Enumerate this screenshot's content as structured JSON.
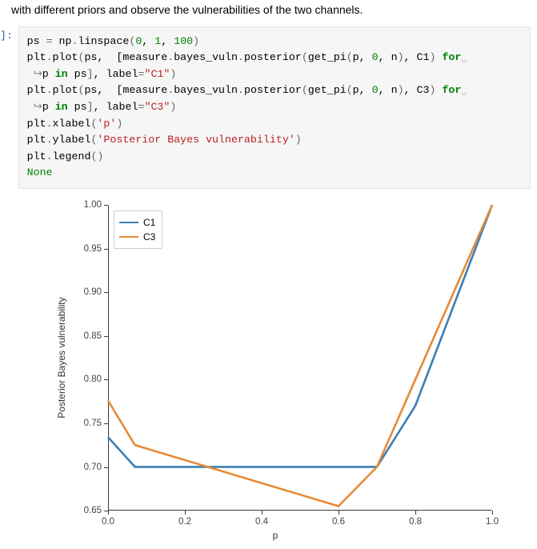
{
  "intro_text": "with different priors and observe the vulnerabilities of the two channels.",
  "prompt_in": "]:",
  "code": {
    "l1_a": "ps ",
    "l1_b": " np",
    "l1_c": "linspace",
    "l1_lp": "(",
    "l1_n1": "0",
    "l1_c1": ", ",
    "l1_n2": "1",
    "l1_c2": ", ",
    "l1_n3": "100",
    "l1_rp": ")",
    "plt": "plt",
    "dot": ".",
    "eq": "=",
    "plot": "plot",
    "lp": "(",
    "rp": ")",
    "ps_arg": "ps",
    "comma_sp": ", ",
    "lb": " [",
    "measure": "measure",
    "bayes_vuln": "bayes_vuln",
    "posterior": "posterior",
    "get_pi": "get_pi",
    "p_var": "p",
    "zero": "0",
    "n_var": "n",
    "C1": "C1",
    "C3": "C3",
    "rb_comma": "]",
    "for_kw": "for",
    "in_kw": "in",
    "arrow": " ↪",
    "space_for": " ",
    "trailing_sp": "␣",
    "label_kw": "label",
    "label_C1": "\"C1\"",
    "label_C3": "\"C3\"",
    "xlabel": "xlabel",
    "ylabel": "ylabel",
    "legend": "legend",
    "str_p": "'p'",
    "str_ylab": "'Posterior Bayes vulnerability'",
    "none": "None"
  },
  "chart_data": {
    "type": "line",
    "title": "",
    "xlabel": "p",
    "ylabel": "Posterior Bayes vulnerability",
    "xlim": [
      0.0,
      1.0
    ],
    "ylim": [
      0.65,
      1.0
    ],
    "xticks": [
      0.0,
      0.2,
      0.4,
      0.6,
      0.8,
      1.0
    ],
    "yticks": [
      0.65,
      0.7,
      0.75,
      0.8,
      0.85,
      0.9,
      0.95,
      1.0
    ],
    "legend_position": "upper-left",
    "series": [
      {
        "name": "C1",
        "color": "#3b7fb5",
        "x": [
          0.0,
          0.07,
          0.7,
          0.8,
          1.0
        ],
        "values": [
          0.734,
          0.7,
          0.7,
          0.77,
          1.0
        ]
      },
      {
        "name": "C3",
        "color": "#e58a37",
        "x": [
          0.0,
          0.07,
          0.6,
          0.7,
          1.0
        ],
        "values": [
          0.776,
          0.725,
          0.655,
          0.7,
          1.0
        ]
      }
    ]
  }
}
